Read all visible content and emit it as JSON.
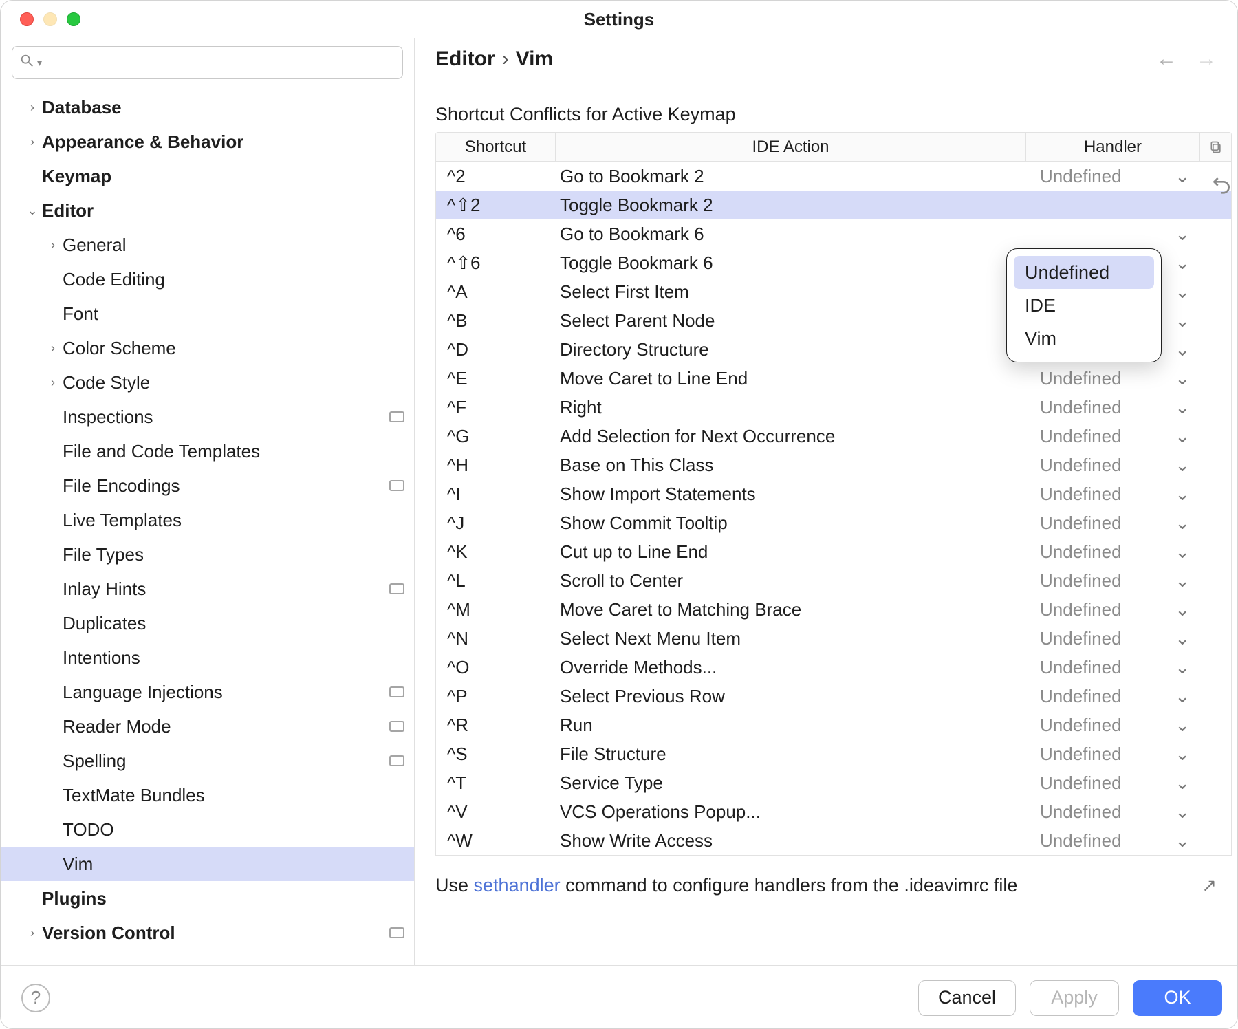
{
  "window": {
    "title": "Settings"
  },
  "breadcrumb": {
    "parent": "Editor",
    "current": "Vim"
  },
  "section_title": "Shortcut Conflicts for Active Keymap",
  "columns": {
    "shortcut": "Shortcut",
    "action": "IDE Action",
    "handler": "Handler"
  },
  "handler_default": "Undefined",
  "sidebar": {
    "items": [
      {
        "label": "Database",
        "bold": true,
        "indent": 0,
        "chev": "right"
      },
      {
        "label": "Appearance & Behavior",
        "bold": true,
        "indent": 0,
        "chev": "right"
      },
      {
        "label": "Keymap",
        "bold": true,
        "indent": 0,
        "chev": ""
      },
      {
        "label": "Editor",
        "bold": true,
        "indent": 0,
        "chev": "down"
      },
      {
        "label": "General",
        "indent": 1,
        "chev": "right"
      },
      {
        "label": "Code Editing",
        "indent": 1,
        "chev": ""
      },
      {
        "label": "Font",
        "indent": 1,
        "chev": ""
      },
      {
        "label": "Color Scheme",
        "indent": 1,
        "chev": "right"
      },
      {
        "label": "Code Style",
        "indent": 1,
        "chev": "right"
      },
      {
        "label": "Inspections",
        "indent": 1,
        "chev": "",
        "badge": true
      },
      {
        "label": "File and Code Templates",
        "indent": 1,
        "chev": ""
      },
      {
        "label": "File Encodings",
        "indent": 1,
        "chev": "",
        "badge": true
      },
      {
        "label": "Live Templates",
        "indent": 1,
        "chev": ""
      },
      {
        "label": "File Types",
        "indent": 1,
        "chev": ""
      },
      {
        "label": "Inlay Hints",
        "indent": 1,
        "chev": "",
        "badge": true
      },
      {
        "label": "Duplicates",
        "indent": 1,
        "chev": ""
      },
      {
        "label": "Intentions",
        "indent": 1,
        "chev": ""
      },
      {
        "label": "Language Injections",
        "indent": 1,
        "chev": "",
        "badge": true
      },
      {
        "label": "Reader Mode",
        "indent": 1,
        "chev": "",
        "badge": true
      },
      {
        "label": "Spelling",
        "indent": 1,
        "chev": "",
        "badge": true
      },
      {
        "label": "TextMate Bundles",
        "indent": 1,
        "chev": ""
      },
      {
        "label": "TODO",
        "indent": 1,
        "chev": ""
      },
      {
        "label": "Vim",
        "indent": 1,
        "chev": "",
        "selected": true
      },
      {
        "label": "Plugins",
        "bold": true,
        "indent": 0,
        "chev": ""
      },
      {
        "label": "Version Control",
        "bold": true,
        "indent": 0,
        "chev": "right",
        "badge": true
      }
    ]
  },
  "rows": [
    {
      "shortcut": "^2",
      "action": "Go to Bookmark 2",
      "handler": "Undefined"
    },
    {
      "shortcut": "^⇧2",
      "action": "Toggle Bookmark 2",
      "handler": "",
      "selected": true
    },
    {
      "shortcut": "^6",
      "action": "Go to Bookmark 6",
      "handler": "",
      "chev": true
    },
    {
      "shortcut": "^⇧6",
      "action": "Toggle Bookmark 6",
      "handler": "",
      "chev": true
    },
    {
      "shortcut": "^A",
      "action": "Select First Item",
      "handler": "",
      "chev": true
    },
    {
      "shortcut": "^B",
      "action": "Select Parent Node",
      "handler": "",
      "chev": true
    },
    {
      "shortcut": "^D",
      "action": "Directory Structure",
      "handler": "Undefined",
      "chev": true
    },
    {
      "shortcut": "^E",
      "action": "Move Caret to Line End",
      "handler": "Undefined",
      "chev": true
    },
    {
      "shortcut": "^F",
      "action": "Right",
      "handler": "Undefined",
      "chev": true
    },
    {
      "shortcut": "^G",
      "action": "Add Selection for Next Occurrence",
      "handler": "Undefined",
      "chev": true
    },
    {
      "shortcut": "^H",
      "action": "Base on This Class",
      "handler": "Undefined",
      "chev": true
    },
    {
      "shortcut": "^I",
      "action": "Show Import Statements",
      "handler": "Undefined",
      "chev": true
    },
    {
      "shortcut": "^J",
      "action": "Show Commit Tooltip",
      "handler": "Undefined",
      "chev": true
    },
    {
      "shortcut": "^K",
      "action": "Cut up to Line End",
      "handler": "Undefined",
      "chev": true
    },
    {
      "shortcut": "^L",
      "action": "Scroll to Center",
      "handler": "Undefined",
      "chev": true
    },
    {
      "shortcut": "^M",
      "action": "Move Caret to Matching Brace",
      "handler": "Undefined",
      "chev": true
    },
    {
      "shortcut": "^N",
      "action": "Select Next Menu Item",
      "handler": "Undefined",
      "chev": true
    },
    {
      "shortcut": "^O",
      "action": "Override Methods...",
      "handler": "Undefined",
      "chev": true
    },
    {
      "shortcut": "^P",
      "action": "Select Previous Row",
      "handler": "Undefined",
      "chev": true
    },
    {
      "shortcut": "^R",
      "action": "Run",
      "handler": "Undefined",
      "chev": true
    },
    {
      "shortcut": "^S",
      "action": "File Structure",
      "handler": "Undefined",
      "chev": true
    },
    {
      "shortcut": "^T",
      "action": "Service Type",
      "handler": "Undefined",
      "chev": true
    },
    {
      "shortcut": "^V",
      "action": "VCS Operations Popup...",
      "handler": "Undefined",
      "chev": true
    },
    {
      "shortcut": "^W",
      "action": "Show Write Access",
      "handler": "Undefined",
      "chev": true
    }
  ],
  "popup": {
    "items": [
      "Undefined",
      "IDE",
      "Vim"
    ],
    "selected": 0
  },
  "hint": {
    "prefix": "Use ",
    "command": "sethandler",
    "suffix": " command to configure handlers from the .ideavimrc file"
  },
  "footer": {
    "cancel": "Cancel",
    "apply": "Apply",
    "ok": "OK"
  }
}
